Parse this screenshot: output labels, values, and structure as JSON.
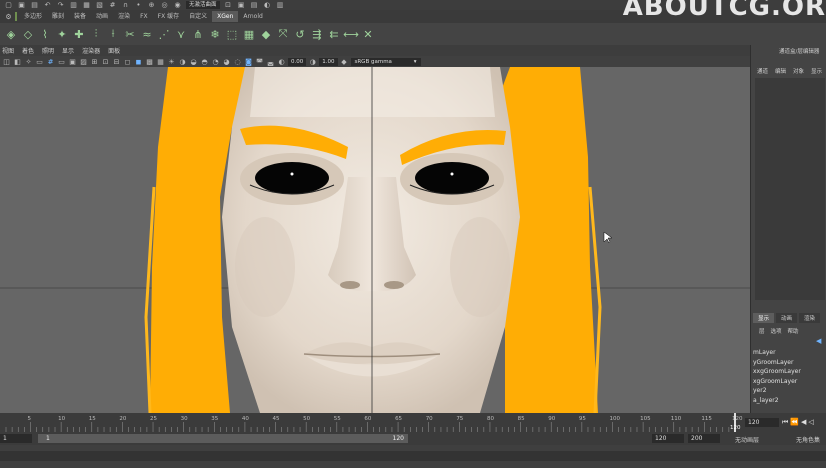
{
  "top_toolbar": {
    "workspace_label": "无激活曲面"
  },
  "shelf_tabs": [
    {
      "label": "多边形",
      "active": false
    },
    {
      "label": "雕刻",
      "active": false
    },
    {
      "label": "装备",
      "active": false
    },
    {
      "label": "动画",
      "active": false
    },
    {
      "label": "渲染",
      "active": false
    },
    {
      "label": "FX",
      "active": false
    },
    {
      "label": "FX 缓存",
      "active": false
    },
    {
      "label": "自定义",
      "active": false
    },
    {
      "label": "XGen",
      "active": true
    },
    {
      "label": "Arnold",
      "active": false
    }
  ],
  "panel_menu": [
    "视图",
    "着色",
    "照明",
    "显示",
    "渲染器",
    "面板"
  ],
  "panel_toolbar": {
    "exposure_value": "0.00",
    "gamma_value": "1.00",
    "color_space": "sRGB gamma"
  },
  "watermark": "ABOUTCG.OR",
  "right_panel": {
    "title": "通道盒/层编辑器",
    "channel_tabs": [
      "通道",
      "编辑",
      "对象",
      "显示"
    ],
    "layer_tabs": [
      {
        "label": "显示",
        "active": true
      },
      {
        "label": "动画",
        "active": false
      },
      {
        "label": "渲染",
        "active": false
      }
    ],
    "layer_menu": [
      "层",
      "选项",
      "帮助"
    ],
    "layers": [
      "mLayer",
      "yGroomLayer",
      "xxgGroomLayer",
      "xgGroomLayer",
      "yer2",
      "a_layer2"
    ]
  },
  "time_slider": {
    "ticks": [
      "5",
      "10",
      "15",
      "20",
      "25",
      "30",
      "35",
      "40",
      "45",
      "50",
      "55",
      "60",
      "65",
      "70",
      "75",
      "80",
      "85",
      "90",
      "95",
      "100",
      "105",
      "110",
      "115",
      "120"
    ],
    "current_frame": "120",
    "end_marker": "120"
  },
  "range_bar": {
    "start_frame": "1",
    "range_start": "1",
    "range_end_inner": "120",
    "range_end": "120",
    "anim_end": "200",
    "char_set": "无动画层",
    "char_set2": "无角色集"
  },
  "colors": {
    "hair": "#ffad05",
    "skin": "#e8dccf",
    "viewport_bg": "#666666",
    "accent_blue": "#6fb4ff"
  }
}
